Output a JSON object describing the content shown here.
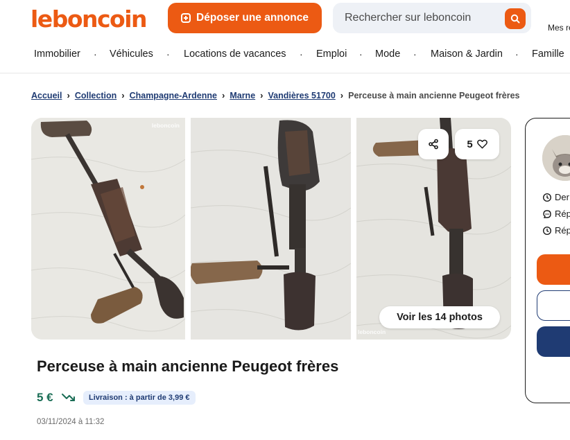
{
  "header": {
    "logo": "leboncoin",
    "deposit_label": "Déposer une annonce",
    "search_placeholder": "Rechercher sur leboncoin",
    "account_label": "Mes re"
  },
  "nav": {
    "items": [
      "Immobilier",
      "Véhicules",
      "Locations de vacances",
      "Emploi",
      "Mode",
      "Maison & Jardin",
      "Famille"
    ]
  },
  "breadcrumb": {
    "items": [
      "Accueil",
      "Collection",
      "Champagne-Ardenne",
      "Marne",
      "Vandières 51700"
    ],
    "current": "Perceuse à main ancienne Peugeot frères"
  },
  "gallery": {
    "watermark": "leboncoin",
    "favorites_count": "5",
    "photos_button": "Voir les 14 photos"
  },
  "ad": {
    "title": "Perceuse à main ancienne Peugeot frères",
    "price": "5 €",
    "delivery": "Livraison : à partir de 3,99 €",
    "date": "03/11/2024 à 11:32"
  },
  "seller": {
    "rows": [
      "Der",
      "Rép",
      "Rép"
    ]
  },
  "colors": {
    "brand": "#ec5a13",
    "navy": "#1f3b73",
    "price": "#1a6d55"
  }
}
